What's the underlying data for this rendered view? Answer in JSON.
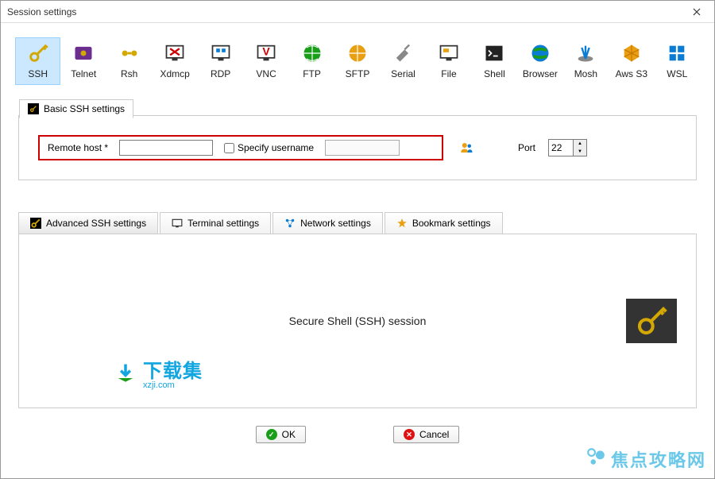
{
  "window": {
    "title": "Session settings"
  },
  "protocols": [
    {
      "id": "ssh",
      "label": "SSH",
      "selected": true
    },
    {
      "id": "telnet",
      "label": "Telnet",
      "selected": false
    },
    {
      "id": "rsh",
      "label": "Rsh",
      "selected": false
    },
    {
      "id": "xdmcp",
      "label": "Xdmcp",
      "selected": false
    },
    {
      "id": "rdp",
      "label": "RDP",
      "selected": false
    },
    {
      "id": "vnc",
      "label": "VNC",
      "selected": false
    },
    {
      "id": "ftp",
      "label": "FTP",
      "selected": false
    },
    {
      "id": "sftp",
      "label": "SFTP",
      "selected": false
    },
    {
      "id": "serial",
      "label": "Serial",
      "selected": false
    },
    {
      "id": "file",
      "label": "File",
      "selected": false
    },
    {
      "id": "shell",
      "label": "Shell",
      "selected": false
    },
    {
      "id": "browser",
      "label": "Browser",
      "selected": false
    },
    {
      "id": "mosh",
      "label": "Mosh",
      "selected": false
    },
    {
      "id": "awss3",
      "label": "Aws S3",
      "selected": false
    },
    {
      "id": "wsl",
      "label": "WSL",
      "selected": false
    }
  ],
  "basic_tab": {
    "label": "Basic SSH settings"
  },
  "form": {
    "remote_host_label": "Remote host *",
    "remote_host_value": "",
    "specify_username_label": "Specify username",
    "specify_username_checked": false,
    "username_value": "",
    "port_label": "Port",
    "port_value": "22"
  },
  "adv_tabs": {
    "advanced": "Advanced SSH settings",
    "terminal": "Terminal settings",
    "network": "Network settings",
    "bookmark": "Bookmark settings"
  },
  "content": {
    "title": "Secure Shell (SSH) session"
  },
  "buttons": {
    "ok": "OK",
    "cancel": "Cancel"
  },
  "watermarks": {
    "main_cn": "下载集",
    "main_url": "xzji.com",
    "corner": "焦点攻略网"
  }
}
